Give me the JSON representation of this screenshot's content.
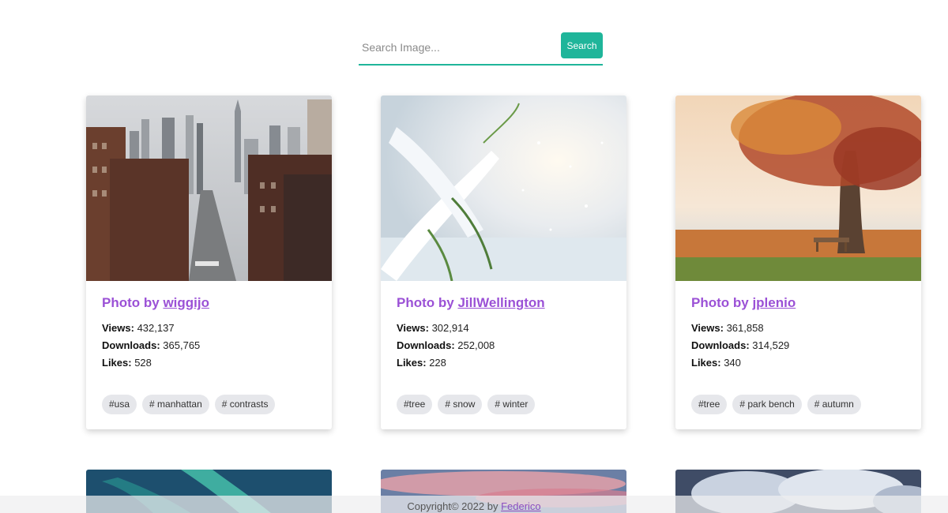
{
  "search": {
    "placeholder": "Search Image...",
    "button_label": "Search"
  },
  "cards": [
    {
      "title_prefix": "Photo by ",
      "author": "wiggijo",
      "views_label": "Views:",
      "views": "432,137",
      "downloads_label": "Downloads:",
      "downloads": "365,765",
      "likes_label": "Likes:",
      "likes": "528",
      "tags": [
        "#usa",
        "# manhattan",
        "# contrasts"
      ]
    },
    {
      "title_prefix": "Photo by ",
      "author": "JillWellington",
      "views_label": "Views:",
      "views": "302,914",
      "downloads_label": "Downloads:",
      "downloads": "252,008",
      "likes_label": "Likes:",
      "likes": "228",
      "tags": [
        "#tree",
        "# snow",
        "# winter"
      ]
    },
    {
      "title_prefix": "Photo by ",
      "author": "jplenio",
      "views_label": "Views:",
      "views": "361,858",
      "downloads_label": "Downloads:",
      "downloads": "314,529",
      "likes_label": "Likes:",
      "likes": "340",
      "tags": [
        "#tree",
        "# park bench",
        "# autumn"
      ]
    }
  ],
  "footer": {
    "text": "Copyright© 2022 by ",
    "author": "Federico"
  },
  "colors": {
    "accent": "#1fb59a",
    "title": "#9b51d6",
    "tag_bg": "#e6e7eb"
  }
}
